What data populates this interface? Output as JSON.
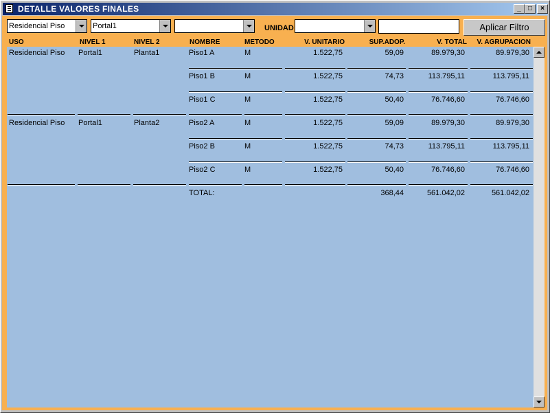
{
  "window": {
    "title": "DETALLE VALORES FINALES",
    "min_icon": "minimize-icon",
    "max_icon": "maximize-icon",
    "close_icon": "close-icon",
    "min_glyph": "_",
    "max_glyph": "□",
    "close_glyph": "×"
  },
  "filters": {
    "uso_value": "Residencial Piso",
    "nivel1_value": "Portal1",
    "nivel2_value": "",
    "unidad_label": "UNIDAD",
    "unidad_value": "",
    "text_value": "",
    "apply_label": "Aplicar Filtro"
  },
  "columns": [
    "USO",
    "NIVEL 1",
    "NIVEL 2",
    "NOMBRE",
    "METODO",
    "V. UNITARIO",
    "SUP.ADOP.",
    "V. TOTAL",
    "V. AGRUPACION"
  ],
  "rows": [
    {
      "uso": "Residencial Piso",
      "nivel1": "Portal1",
      "nivel2": "Planta1",
      "nombre": "Piso1 A",
      "metodo": "M",
      "v_unitario": "1.522,75",
      "sup": "59,09",
      "v_total": "89.979,30",
      "v_agrup": "89.979,30"
    },
    {
      "uso": "",
      "nivel1": "",
      "nivel2": "",
      "nombre": "Piso1 B",
      "metodo": "M",
      "v_unitario": "1.522,75",
      "sup": "74,73",
      "v_total": "113.795,11",
      "v_agrup": "113.795,11"
    },
    {
      "uso": "",
      "nivel1": "",
      "nivel2": "",
      "nombre": "Piso1 C",
      "metodo": "M",
      "v_unitario": "1.522,75",
      "sup": "50,40",
      "v_total": "76.746,60",
      "v_agrup": "76.746,60"
    },
    {
      "uso": "Residencial Piso",
      "nivel1": "Portal1",
      "nivel2": "Planta2",
      "nombre": "Piso2 A",
      "metodo": "M",
      "v_unitario": "1.522,75",
      "sup": "59,09",
      "v_total": "89.979,30",
      "v_agrup": "89.979,30"
    },
    {
      "uso": "",
      "nivel1": "",
      "nivel2": "",
      "nombre": "Piso2 B",
      "metodo": "M",
      "v_unitario": "1.522,75",
      "sup": "74,73",
      "v_total": "113.795,11",
      "v_agrup": "113.795,11"
    },
    {
      "uso": "",
      "nivel1": "",
      "nivel2": "",
      "nombre": "Piso2 C",
      "metodo": "M",
      "v_unitario": "1.522,75",
      "sup": "50,40",
      "v_total": "76.746,60",
      "v_agrup": "76.746,60"
    }
  ],
  "total": {
    "label": "TOTAL:",
    "sup": "368,44",
    "v_total": "561.042,02",
    "v_agrup": "561.042,02"
  },
  "colors": {
    "background": "#f8b050",
    "grid": "#a0bedf",
    "title_from": "#0a246a",
    "title_to": "#a6caf0"
  }
}
